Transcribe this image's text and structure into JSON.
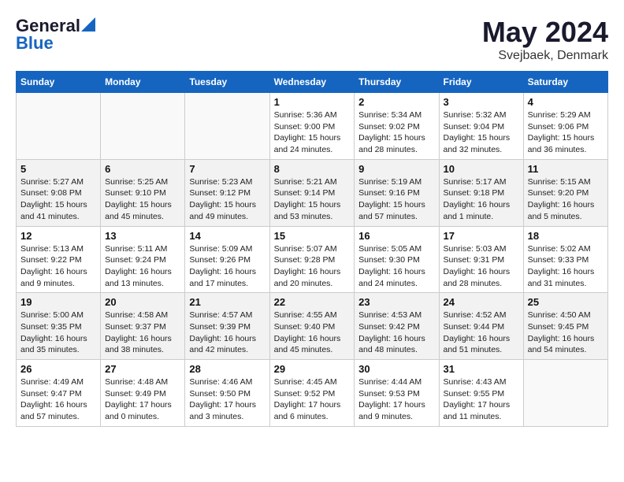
{
  "header": {
    "logo_general": "General",
    "logo_blue": "Blue",
    "month": "May 2024",
    "location": "Svejbaek, Denmark"
  },
  "weekdays": [
    "Sunday",
    "Monday",
    "Tuesday",
    "Wednesday",
    "Thursday",
    "Friday",
    "Saturday"
  ],
  "weeks": [
    {
      "days": [
        {
          "number": "",
          "info": ""
        },
        {
          "number": "",
          "info": ""
        },
        {
          "number": "",
          "info": ""
        },
        {
          "number": "1",
          "info": "Sunrise: 5:36 AM\nSunset: 9:00 PM\nDaylight: 15 hours\nand 24 minutes."
        },
        {
          "number": "2",
          "info": "Sunrise: 5:34 AM\nSunset: 9:02 PM\nDaylight: 15 hours\nand 28 minutes."
        },
        {
          "number": "3",
          "info": "Sunrise: 5:32 AM\nSunset: 9:04 PM\nDaylight: 15 hours\nand 32 minutes."
        },
        {
          "number": "4",
          "info": "Sunrise: 5:29 AM\nSunset: 9:06 PM\nDaylight: 15 hours\nand 36 minutes."
        }
      ]
    },
    {
      "days": [
        {
          "number": "5",
          "info": "Sunrise: 5:27 AM\nSunset: 9:08 PM\nDaylight: 15 hours\nand 41 minutes."
        },
        {
          "number": "6",
          "info": "Sunrise: 5:25 AM\nSunset: 9:10 PM\nDaylight: 15 hours\nand 45 minutes."
        },
        {
          "number": "7",
          "info": "Sunrise: 5:23 AM\nSunset: 9:12 PM\nDaylight: 15 hours\nand 49 minutes."
        },
        {
          "number": "8",
          "info": "Sunrise: 5:21 AM\nSunset: 9:14 PM\nDaylight: 15 hours\nand 53 minutes."
        },
        {
          "number": "9",
          "info": "Sunrise: 5:19 AM\nSunset: 9:16 PM\nDaylight: 15 hours\nand 57 minutes."
        },
        {
          "number": "10",
          "info": "Sunrise: 5:17 AM\nSunset: 9:18 PM\nDaylight: 16 hours\nand 1 minute."
        },
        {
          "number": "11",
          "info": "Sunrise: 5:15 AM\nSunset: 9:20 PM\nDaylight: 16 hours\nand 5 minutes."
        }
      ]
    },
    {
      "days": [
        {
          "number": "12",
          "info": "Sunrise: 5:13 AM\nSunset: 9:22 PM\nDaylight: 16 hours\nand 9 minutes."
        },
        {
          "number": "13",
          "info": "Sunrise: 5:11 AM\nSunset: 9:24 PM\nDaylight: 16 hours\nand 13 minutes."
        },
        {
          "number": "14",
          "info": "Sunrise: 5:09 AM\nSunset: 9:26 PM\nDaylight: 16 hours\nand 17 minutes."
        },
        {
          "number": "15",
          "info": "Sunrise: 5:07 AM\nSunset: 9:28 PM\nDaylight: 16 hours\nand 20 minutes."
        },
        {
          "number": "16",
          "info": "Sunrise: 5:05 AM\nSunset: 9:30 PM\nDaylight: 16 hours\nand 24 minutes."
        },
        {
          "number": "17",
          "info": "Sunrise: 5:03 AM\nSunset: 9:31 PM\nDaylight: 16 hours\nand 28 minutes."
        },
        {
          "number": "18",
          "info": "Sunrise: 5:02 AM\nSunset: 9:33 PM\nDaylight: 16 hours\nand 31 minutes."
        }
      ]
    },
    {
      "days": [
        {
          "number": "19",
          "info": "Sunrise: 5:00 AM\nSunset: 9:35 PM\nDaylight: 16 hours\nand 35 minutes."
        },
        {
          "number": "20",
          "info": "Sunrise: 4:58 AM\nSunset: 9:37 PM\nDaylight: 16 hours\nand 38 minutes."
        },
        {
          "number": "21",
          "info": "Sunrise: 4:57 AM\nSunset: 9:39 PM\nDaylight: 16 hours\nand 42 minutes."
        },
        {
          "number": "22",
          "info": "Sunrise: 4:55 AM\nSunset: 9:40 PM\nDaylight: 16 hours\nand 45 minutes."
        },
        {
          "number": "23",
          "info": "Sunrise: 4:53 AM\nSunset: 9:42 PM\nDaylight: 16 hours\nand 48 minutes."
        },
        {
          "number": "24",
          "info": "Sunrise: 4:52 AM\nSunset: 9:44 PM\nDaylight: 16 hours\nand 51 minutes."
        },
        {
          "number": "25",
          "info": "Sunrise: 4:50 AM\nSunset: 9:45 PM\nDaylight: 16 hours\nand 54 minutes."
        }
      ]
    },
    {
      "days": [
        {
          "number": "26",
          "info": "Sunrise: 4:49 AM\nSunset: 9:47 PM\nDaylight: 16 hours\nand 57 minutes."
        },
        {
          "number": "27",
          "info": "Sunrise: 4:48 AM\nSunset: 9:49 PM\nDaylight: 17 hours\nand 0 minutes."
        },
        {
          "number": "28",
          "info": "Sunrise: 4:46 AM\nSunset: 9:50 PM\nDaylight: 17 hours\nand 3 minutes."
        },
        {
          "number": "29",
          "info": "Sunrise: 4:45 AM\nSunset: 9:52 PM\nDaylight: 17 hours\nand 6 minutes."
        },
        {
          "number": "30",
          "info": "Sunrise: 4:44 AM\nSunset: 9:53 PM\nDaylight: 17 hours\nand 9 minutes."
        },
        {
          "number": "31",
          "info": "Sunrise: 4:43 AM\nSunset: 9:55 PM\nDaylight: 17 hours\nand 11 minutes."
        },
        {
          "number": "",
          "info": ""
        }
      ]
    }
  ]
}
